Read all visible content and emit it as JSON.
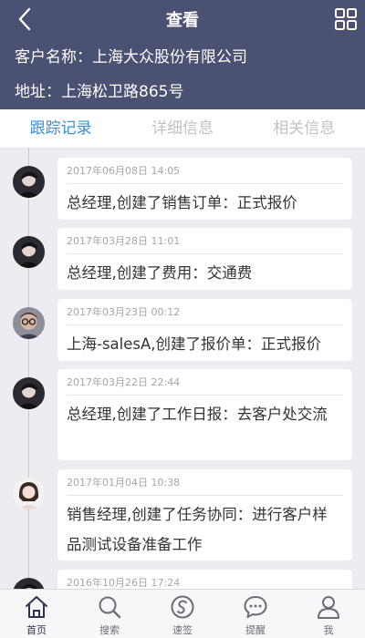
{
  "header": {
    "title": "查看",
    "customer_name": "客户名称：上海大众股份有限公司",
    "address": "地址：上海松卫路865号"
  },
  "tabs": [
    {
      "label": "跟踪记录",
      "active": true
    },
    {
      "label": "详细信息",
      "active": false
    },
    {
      "label": "相关信息",
      "active": false
    }
  ],
  "records": [
    {
      "date": "2017年06月08日 14:05",
      "text": "总经理,创建了销售订单：正式报价",
      "avatar": "man-dark-icon"
    },
    {
      "date": "2017年03月28日 11:01",
      "text": "总经理,创建了费用：交通费",
      "avatar": "man-dark-icon"
    },
    {
      "date": "2017年03月23日 00:12",
      "text": "上海-salesA,创建了报价单：正式报价",
      "avatar": "man-glasses-icon"
    },
    {
      "date": "2017年03月22日 22:44",
      "text": "总经理,创建了工作日报：去客户处交流",
      "avatar": "man-dark-icon"
    },
    {
      "date": "2017年01月04日 10:38",
      "text": "销售经理,创建了任务协同：进行客户样品测试设备准备工作",
      "avatar": "woman-icon"
    },
    {
      "date": "2016年10月26日 17:24",
      "text": "",
      "avatar": "man-dark-icon"
    }
  ],
  "bottom_nav": [
    {
      "label": "首页",
      "icon": "home-icon",
      "active": true
    },
    {
      "label": "搜索",
      "icon": "search-icon",
      "active": false
    },
    {
      "label": "速签",
      "icon": "quick-sign-icon",
      "active": false
    },
    {
      "label": "提醒",
      "icon": "chat-bubble-icon",
      "active": false
    },
    {
      "label": "我",
      "icon": "user-icon",
      "active": false
    }
  ],
  "colors": {
    "header_bg": "#4a5172",
    "tab_active": "#3a8fd0",
    "tab_inactive": "#c0c2c8",
    "page_bg": "#ececf1"
  }
}
